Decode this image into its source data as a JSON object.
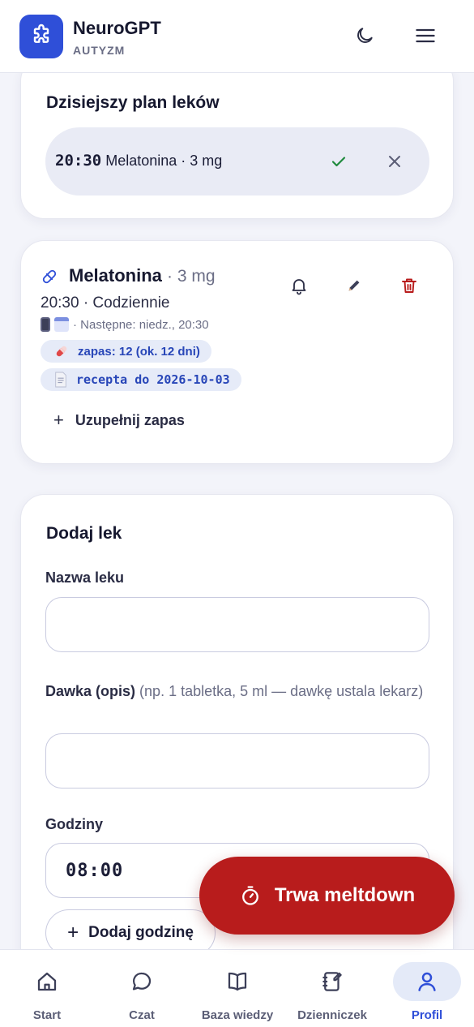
{
  "header": {
    "app_name": "NeuroGPT",
    "app_subtitle": "AUTYZM",
    "icons": [
      "puzzle-logo-icon",
      "moon-icon",
      "hamburger-menu-icon"
    ]
  },
  "plan_card": {
    "title": "Dzisiejszy plan leków",
    "entries": [
      {
        "time": "20:30",
        "text": "Melatonina · 3 mg"
      }
    ]
  },
  "med_card": {
    "name": "Melatonina",
    "dose": "· 3 mg",
    "schedule": "20:30 · Codziennie",
    "next": "· Następne: niedz., 20:30",
    "stock_label": "zapas: 12 (ok. 12 dni)",
    "prescription_label": "recepta do 2026-10-03",
    "refill_label": "Uzupełnij zapas"
  },
  "add_card": {
    "title": "Dodaj lek",
    "name_label": "Nazwa leku",
    "name_value": "",
    "dose_label": "Dawka (opis)",
    "dose_note": "(np. 1 tabletka, 5 ml — dawkę ustala lekarz)",
    "dose_value": "",
    "hours_label": "Godziny",
    "hour_value": "08:00",
    "add_hour_label": "Dodaj godzinę"
  },
  "fab": {
    "label": "Trwa meltdown"
  },
  "bottom_nav": {
    "items": [
      {
        "label": "Start",
        "icon": "home-icon"
      },
      {
        "label": "Czat",
        "icon": "chat-bubble-icon"
      },
      {
        "label": "Baza wiedzy",
        "icon": "book-icon"
      },
      {
        "label": "Dzienniczek",
        "icon": "notebook-icon"
      },
      {
        "label": "Profil",
        "icon": "user-icon"
      }
    ],
    "active": "Profil"
  },
  "colors": {
    "brand": "#2f4fd8",
    "danger": "#b81c1c",
    "success": "#1f8a3d",
    "pill_bg": "#e6ebf8",
    "pill_text": "#2846b8"
  }
}
